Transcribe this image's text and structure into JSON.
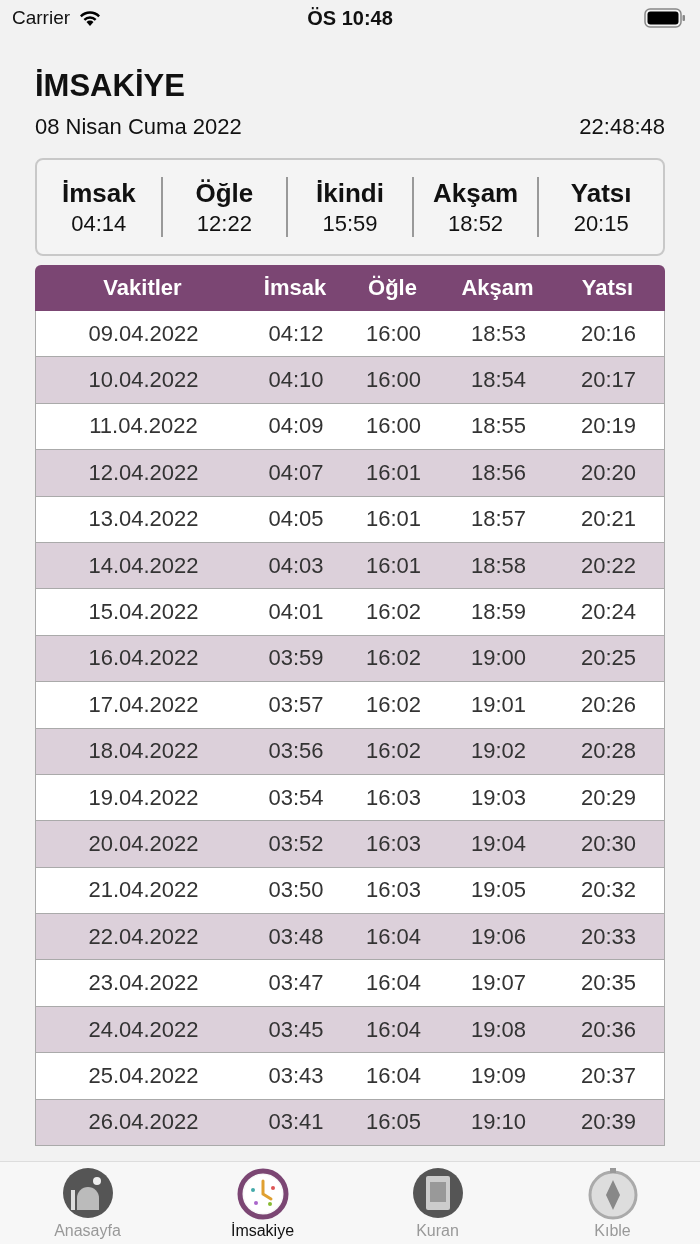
{
  "status_bar": {
    "carrier": "Carrier",
    "time": "ÖS 10:48"
  },
  "header": {
    "title": "İMSAKİYE",
    "date": "08 Nisan Cuma 2022",
    "clock": "22:48:48"
  },
  "today": [
    {
      "name": "İmsak",
      "time": "04:14"
    },
    {
      "name": "Öğle",
      "time": "12:22"
    },
    {
      "name": "İkindi",
      "time": "15:59"
    },
    {
      "name": "Akşam",
      "time": "18:52"
    },
    {
      "name": "Yatsı",
      "time": "20:15"
    }
  ],
  "table": {
    "columns": [
      "Vakitler",
      "İmsak",
      "Öğle",
      "Akşam",
      "Yatsı"
    ],
    "rows": [
      [
        "09.04.2022",
        "04:12",
        "16:00",
        "18:53",
        "20:16"
      ],
      [
        "10.04.2022",
        "04:10",
        "16:00",
        "18:54",
        "20:17"
      ],
      [
        "11.04.2022",
        "04:09",
        "16:00",
        "18:55",
        "20:19"
      ],
      [
        "12.04.2022",
        "04:07",
        "16:01",
        "18:56",
        "20:20"
      ],
      [
        "13.04.2022",
        "04:05",
        "16:01",
        "18:57",
        "20:21"
      ],
      [
        "14.04.2022",
        "04:03",
        "16:01",
        "18:58",
        "20:22"
      ],
      [
        "15.04.2022",
        "04:01",
        "16:02",
        "18:59",
        "20:24"
      ],
      [
        "16.04.2022",
        "03:59",
        "16:02",
        "19:00",
        "20:25"
      ],
      [
        "17.04.2022",
        "03:57",
        "16:02",
        "19:01",
        "20:26"
      ],
      [
        "18.04.2022",
        "03:56",
        "16:02",
        "19:02",
        "20:28"
      ],
      [
        "19.04.2022",
        "03:54",
        "16:03",
        "19:03",
        "20:29"
      ],
      [
        "20.04.2022",
        "03:52",
        "16:03",
        "19:04",
        "20:30"
      ],
      [
        "21.04.2022",
        "03:50",
        "16:03",
        "19:05",
        "20:32"
      ],
      [
        "22.04.2022",
        "03:48",
        "16:04",
        "19:06",
        "20:33"
      ],
      [
        "23.04.2022",
        "03:47",
        "16:04",
        "19:07",
        "20:35"
      ],
      [
        "24.04.2022",
        "03:45",
        "16:04",
        "19:08",
        "20:36"
      ],
      [
        "25.04.2022",
        "03:43",
        "16:04",
        "19:09",
        "20:37"
      ],
      [
        "26.04.2022",
        "03:41",
        "16:05",
        "19:10",
        "20:39"
      ]
    ]
  },
  "tab_bar": [
    {
      "label": "Anasayfa",
      "selected": false
    },
    {
      "label": "İmsakiye",
      "selected": true
    },
    {
      "label": "Kuran",
      "selected": false
    },
    {
      "label": "Kıble",
      "selected": false
    }
  ]
}
